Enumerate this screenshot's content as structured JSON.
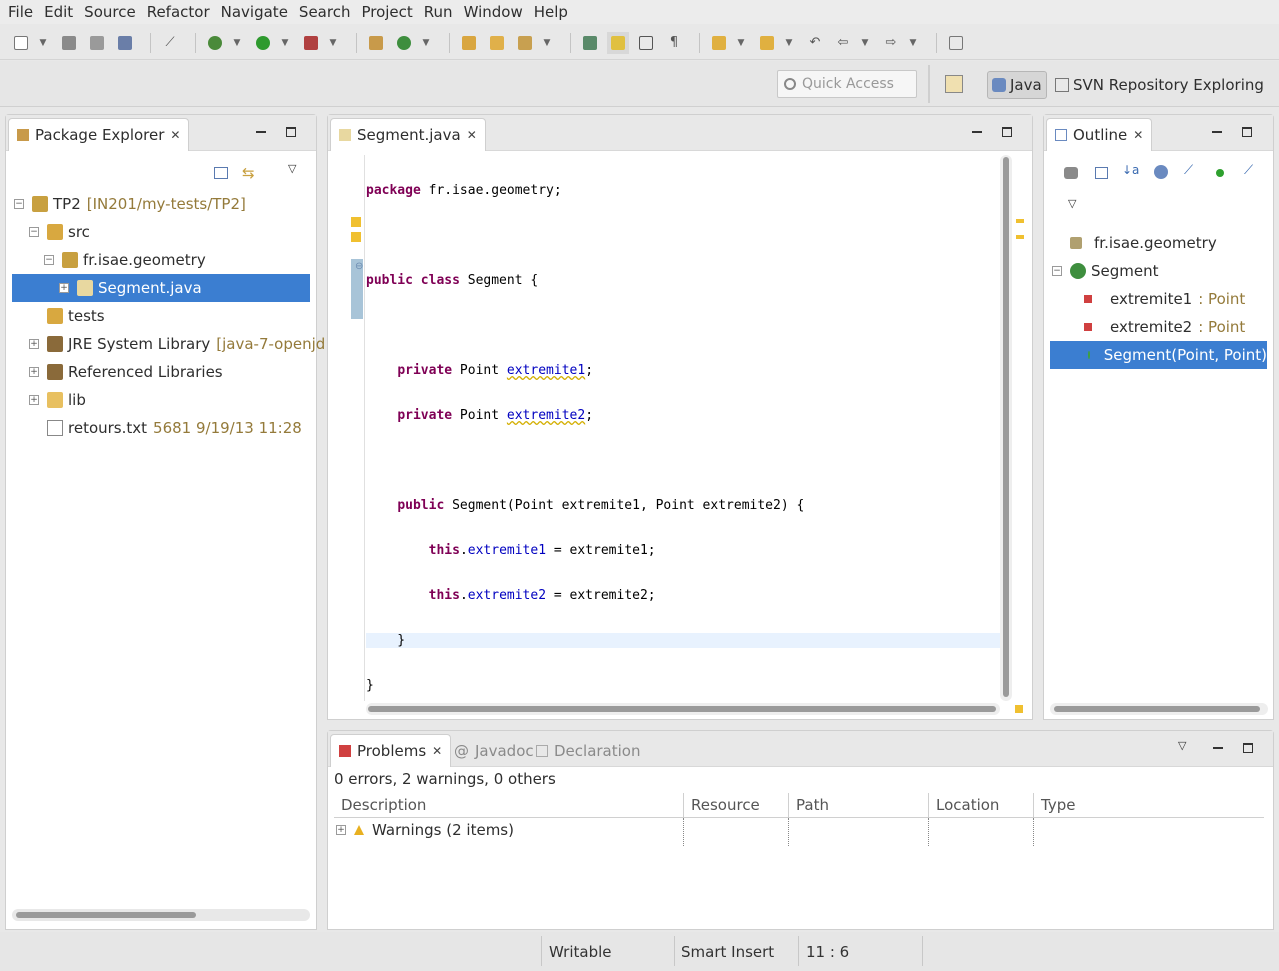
{
  "menu": [
    "File",
    "Edit",
    "Source",
    "Refactor",
    "Navigate",
    "Search",
    "Project",
    "Run",
    "Window",
    "Help"
  ],
  "quick_access": {
    "placeholder": "Quick Access"
  },
  "perspectives": {
    "java": "Java",
    "svn": "SVN Repository Exploring"
  },
  "package_explorer": {
    "tab_label": "Package Explorer",
    "tree": [
      {
        "label": "TP2",
        "decoration": "[IN201/my-tests/TP2]",
        "expanded": true
      },
      {
        "label": "src",
        "decoration": "",
        "expanded": true
      },
      {
        "label": "fr.isae.geometry",
        "decoration": "",
        "expanded": true
      },
      {
        "label": "Segment.java",
        "decoration": "",
        "expanded": false,
        "selected": true
      },
      {
        "label": "tests",
        "decoration": ""
      },
      {
        "label": "JRE System Library",
        "decoration": "[java-7-openjd"
      },
      {
        "label": "Referenced Libraries",
        "decoration": ""
      },
      {
        "label": "lib",
        "decoration": ""
      },
      {
        "label": "retours.txt",
        "decoration": "5681  9/19/13 11:28"
      }
    ]
  },
  "editor": {
    "tab_label": "Segment.java",
    "lines": [
      "package fr.isae.geometry;",
      "",
      "public class Segment {",
      "",
      "    private Point extremite1;",
      "    private Point extremite2;",
      "",
      "    public Segment(Point extremite1, Point extremite2) {",
      "        this.extremite1 = extremite1;",
      "        this.extremite2 = extremite2;",
      "    }",
      "}"
    ]
  },
  "outline": {
    "tab_label": "Outline",
    "items": [
      {
        "label": "fr.isae.geometry",
        "type": ""
      },
      {
        "label": "Segment",
        "type": ""
      },
      {
        "label": "extremite1",
        "type": ": Point"
      },
      {
        "label": "extremite2",
        "type": ": Point"
      },
      {
        "label": "Segment(Point, Point)",
        "type": "",
        "selected": true
      }
    ]
  },
  "bottom_tabs": {
    "problems": "Problems",
    "javadoc": "Javadoc",
    "declaration": "Declaration"
  },
  "problems": {
    "summary": "0 errors, 2 warnings, 0 others",
    "columns": [
      "Description",
      "Resource",
      "Path",
      "Location",
      "Type"
    ],
    "rows": [
      {
        "description": "Warnings (2 items)"
      }
    ]
  },
  "status": {
    "writable": "Writable",
    "insert_mode": "Smart Insert",
    "position": "11 : 6"
  },
  "colors": {
    "selection": "#3b7ed1",
    "keyword": "#7f0055",
    "field": "#0000c0",
    "decoration": "#947a3a"
  }
}
